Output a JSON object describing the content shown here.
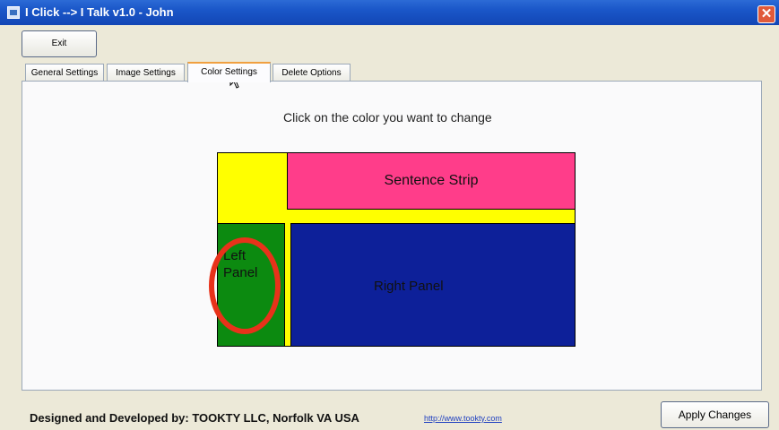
{
  "window": {
    "title": "I Click --> I Talk v1.0 - John",
    "close_glyph": "✕"
  },
  "toolbar": {
    "exit_label": "Exit"
  },
  "tabs": [
    {
      "label": "General Settings",
      "active": false
    },
    {
      "label": "Image Settings",
      "active": false
    },
    {
      "label": "Color Settings",
      "active": true
    },
    {
      "label": "Delete Options",
      "active": false
    }
  ],
  "color_settings": {
    "instruction": "Click on the color you want to change",
    "regions": {
      "sentence_strip": {
        "label": "Sentence Strip",
        "color": "#ff3d8a"
      },
      "left_panel": {
        "label_line1": "Left",
        "label_line2": "Panel",
        "color": "#0c8a10"
      },
      "right_panel": {
        "label": "Right Panel",
        "color": "#0d2099"
      },
      "background": {
        "color": "#ffff00"
      }
    },
    "highlight_color": "#e8321a"
  },
  "footer": {
    "credit": "Designed and Developed by: TOOKTY    LLC,  Norfolk VA USA",
    "link": "http://www.tookty.com",
    "apply_label": "Apply Changes"
  },
  "colors": {
    "titlebar": "#1a56c8",
    "window_bg": "#ece9d8",
    "active_tab_accent": "#f0a040"
  },
  "icons": [
    "app-icon",
    "close-icon",
    "mouse-cursor-icon"
  ]
}
